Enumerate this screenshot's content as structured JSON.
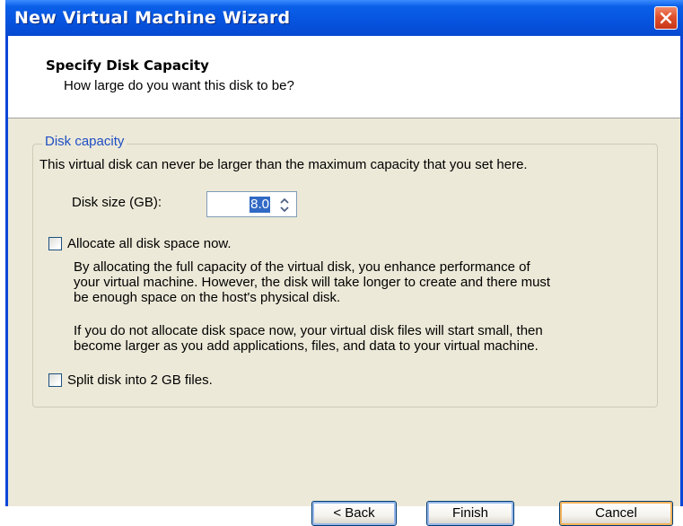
{
  "window": {
    "title": "New Virtual Machine Wizard"
  },
  "header": {
    "title": "Specify Disk Capacity",
    "subtitle": "How large do you want this disk to be?"
  },
  "group": {
    "legend": "Disk capacity",
    "description": "This virtual disk can never be larger than the maximum capacity that you set here.",
    "disk_size_label": "Disk size (GB):",
    "disk_size_value": "8.0"
  },
  "allocate": {
    "label": "Allocate all disk space now.",
    "checked": false,
    "para1": [
      "By allocating the full capacity of the virtual disk, you enhance performance of",
      "your virtual machine.  However, the disk will take longer to create and there must",
      "be enough space on the host's physical disk."
    ],
    "para2": [
      "If you do not allocate disk space now, your virtual disk files will start small, then",
      "become larger as you add applications, files, and data to your virtual machine."
    ]
  },
  "split": {
    "label": "Split disk into 2 GB files.",
    "checked": false
  },
  "buttons": {
    "back": "< Back",
    "finish": "Finish",
    "cancel": "Cancel"
  },
  "colors": {
    "title_bar": "#0755e0",
    "legend_text": "#1f4ec4",
    "selection": "#316ac5"
  }
}
